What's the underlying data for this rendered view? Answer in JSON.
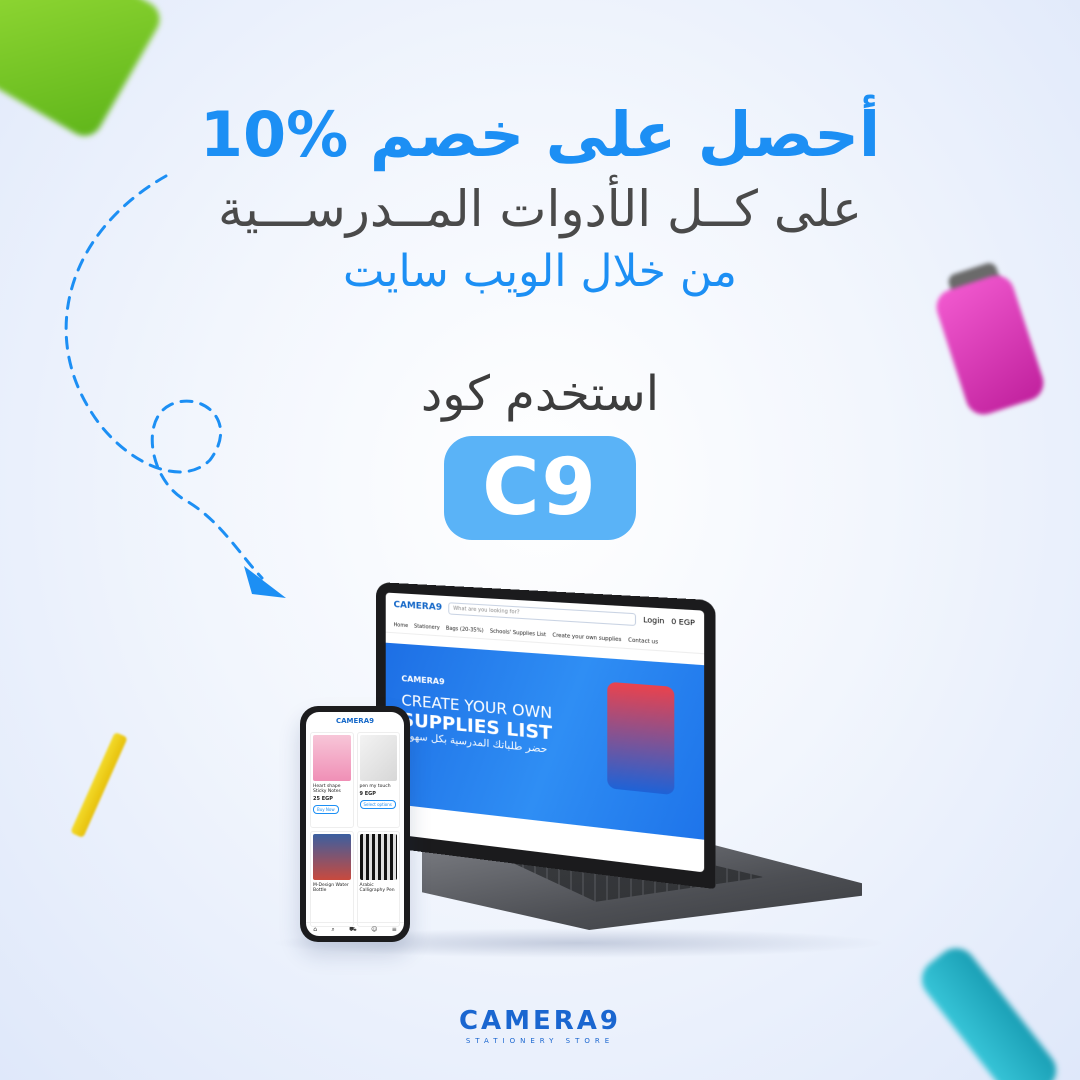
{
  "headline": {
    "line1_text": "أحصل على خصم",
    "line1_percent": "10%",
    "line2": "على كــل الأدوات المــدرســـية",
    "line3": "من خلال الويب سايت",
    "code_label": "استخدم كود",
    "code_value": "C9"
  },
  "colors": {
    "accent_blue": "#1c8ff4",
    "badge_blue": "#5ab3f7",
    "text_dark": "#4a4a4a",
    "brand_blue": "#1a66d0"
  },
  "laptop_screen": {
    "logo": "CAMERA9",
    "search_placeholder": "What are you looking for?",
    "login": "Login",
    "currency": "0 EGP",
    "nav": [
      "Home",
      "Stationery",
      "Bags (20-35%)",
      "Schools' Supplies List",
      "Create your own supplies",
      "Contact us"
    ],
    "banner": {
      "logo": "CAMERA9",
      "line1": "CREATE YOUR OWN",
      "line2": "SUPPLIES LIST",
      "arabic": "حضر طلباتك المدرسية بكل سهولة"
    }
  },
  "phone_screen": {
    "logo": "CAMERA9",
    "products": [
      {
        "name": "Heart shape Sticky Notes",
        "price": "25 EGP",
        "button": "Buy Now"
      },
      {
        "name": "pen my touch",
        "price": "9 EGP",
        "button": "Select options"
      },
      {
        "name": "M-Design Water Bottle",
        "price": "",
        "button": ""
      },
      {
        "name": "Arabic Calligraphy Pen",
        "price": "",
        "button": ""
      }
    ]
  },
  "footer": {
    "brand": "CAMERA9",
    "tagline": "STATIONERY STORE"
  },
  "icons": {
    "arrow": "dashed-arrow-icon",
    "search": "search-icon",
    "user": "user-icon",
    "cart": "cart-icon"
  }
}
